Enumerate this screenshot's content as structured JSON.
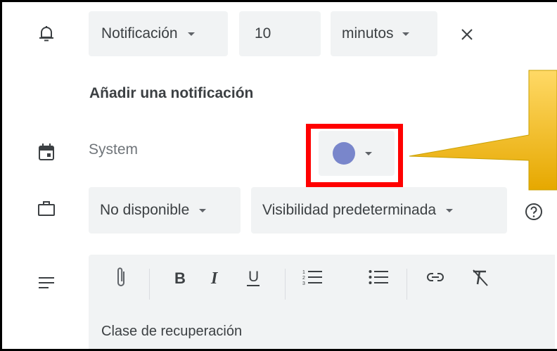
{
  "notification": {
    "type_label": "Notificación",
    "amount_value": "10",
    "unit_label": "minutos",
    "add_label": "Añadir una notificación"
  },
  "calendar": {
    "name": "System",
    "color": "#7986cb"
  },
  "availability": {
    "status_label": "No disponible",
    "visibility_label": "Visibilidad predeterminada"
  },
  "description": {
    "text": "Clase de recuperación"
  },
  "toolbar_icons": [
    "paperclip-icon",
    "bold-icon",
    "italic-icon",
    "underline-icon",
    "numbered-list-icon",
    "bulleted-list-icon",
    "link-icon",
    "clear-formatting-icon"
  ],
  "annotation": {
    "highlight_color": "#ff0000",
    "callout_color": "#ffc000"
  }
}
